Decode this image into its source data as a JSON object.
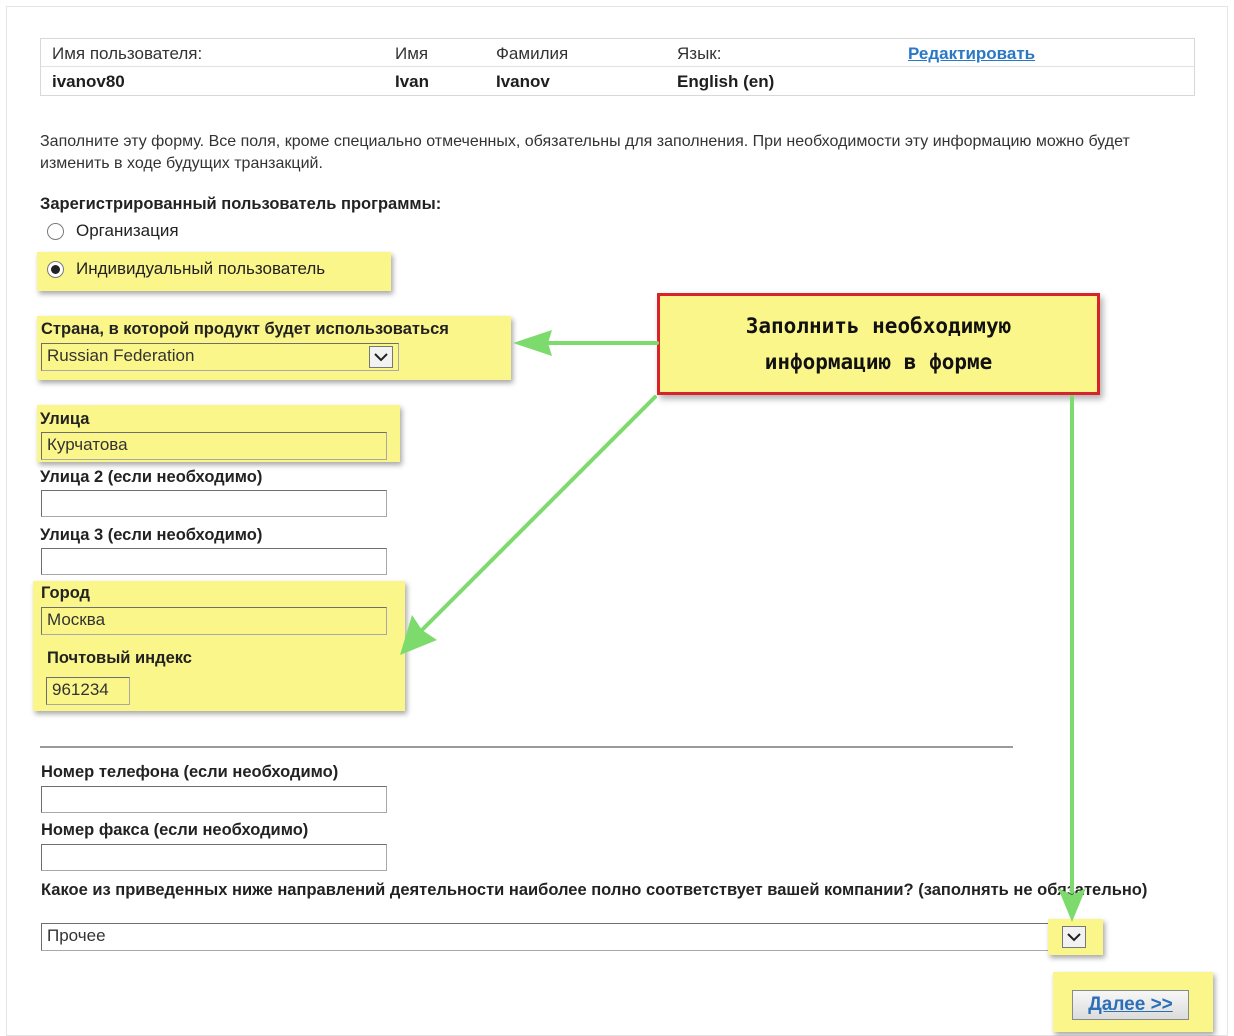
{
  "user_info": {
    "headers": {
      "username": "Имя пользователя:",
      "first_name": "Имя",
      "last_name": "Фамилия",
      "language": "Язык:"
    },
    "edit_link": "Редактировать",
    "values": {
      "username": "ivanov80",
      "first_name": "Ivan",
      "last_name": "Ivanov",
      "language": "English (en)"
    }
  },
  "intro_text": "Заполните эту форму. Все поля, кроме специально отмеченных, обязательны для заполнения. При необходимости эту информацию можно будет изменить в ходе будущих транзакций.",
  "registered_user": {
    "label": "Зарегистрированный пользователь программы:",
    "options": [
      "Организация",
      "Индивидуальный пользователь"
    ],
    "selected": "Индивидуальный пользователь"
  },
  "country": {
    "label": "Страна, в которой продукт будет использоваться",
    "value": "Russian Federation"
  },
  "street": {
    "label": "Улица",
    "value": "Курчатова"
  },
  "street2": {
    "label": "Улица 2 (если необходимо)",
    "value": ""
  },
  "street3": {
    "label": "Улица 3 (если необходимо)",
    "value": ""
  },
  "city": {
    "label": "Город",
    "value": "Москва"
  },
  "postal": {
    "label": "Почтовый индекс",
    "value": "961234"
  },
  "phone": {
    "label": "Номер телефона (если необходимо)",
    "value": ""
  },
  "fax": {
    "label": "Номер факса (если необходимо)",
    "value": ""
  },
  "industry": {
    "label": "Какое из приведенных ниже направлений деятельности наиболее полно соответствует вашей компании? (заполнять не обязательно)",
    "value": "Прочее"
  },
  "callout": {
    "line1": "Заполнить необходимую",
    "line2": "информацию в форме"
  },
  "next_button": "Далее >>",
  "colors": {
    "highlight": "#fbf68a",
    "callout_border": "#d8232a",
    "arrow": "#7ddb6e",
    "link": "#2878c6"
  }
}
